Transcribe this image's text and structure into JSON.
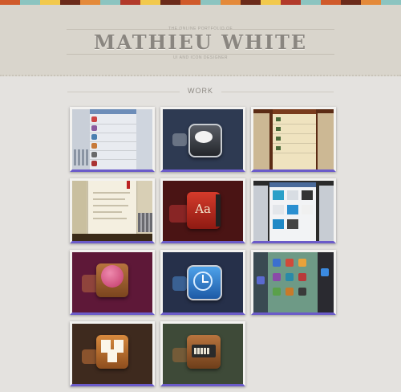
{
  "colors": {
    "stripe": [
      "#d05a2a",
      "#8cc4c0",
      "#f2c94c",
      "#6b2b1a",
      "#e48a3a",
      "#8cc4c0",
      "#b23a2a",
      "#f2c94c",
      "#6b2b1a",
      "#d05a2a",
      "#8cc4c0",
      "#e48a3a",
      "#6b2b1a",
      "#f2c94c",
      "#b23a2a",
      "#8cc4c0",
      "#d05a2a",
      "#6b2b1a",
      "#e48a3a",
      "#8cc4c0"
    ],
    "header_bg": "#d9d5cc",
    "page_bg": "#e4e2df"
  },
  "header": {
    "tagline": "THE ONLINE PORTFOLIO OF",
    "name": "MATHIEU WHITE",
    "subtitle": "UI AND ICON DESIGNER"
  },
  "work": {
    "label": "WORK",
    "items": [
      {
        "icon": "mail-app-screenshot"
      },
      {
        "icon": "messages-bubble-icon"
      },
      {
        "icon": "tasks-list-screenshot"
      },
      {
        "icon": "ebook-reader-screenshot"
      },
      {
        "icon": "dictionary-aa-icon"
      },
      {
        "icon": "web-gallery-screenshot"
      },
      {
        "icon": "dribbble-ball-icon"
      },
      {
        "icon": "clock-icon"
      },
      {
        "icon": "homescreen-icons-screenshot"
      },
      {
        "icon": "document-papers-icon"
      },
      {
        "icon": "battery-box-icon"
      }
    ]
  },
  "dict_icon_text": "Aa"
}
